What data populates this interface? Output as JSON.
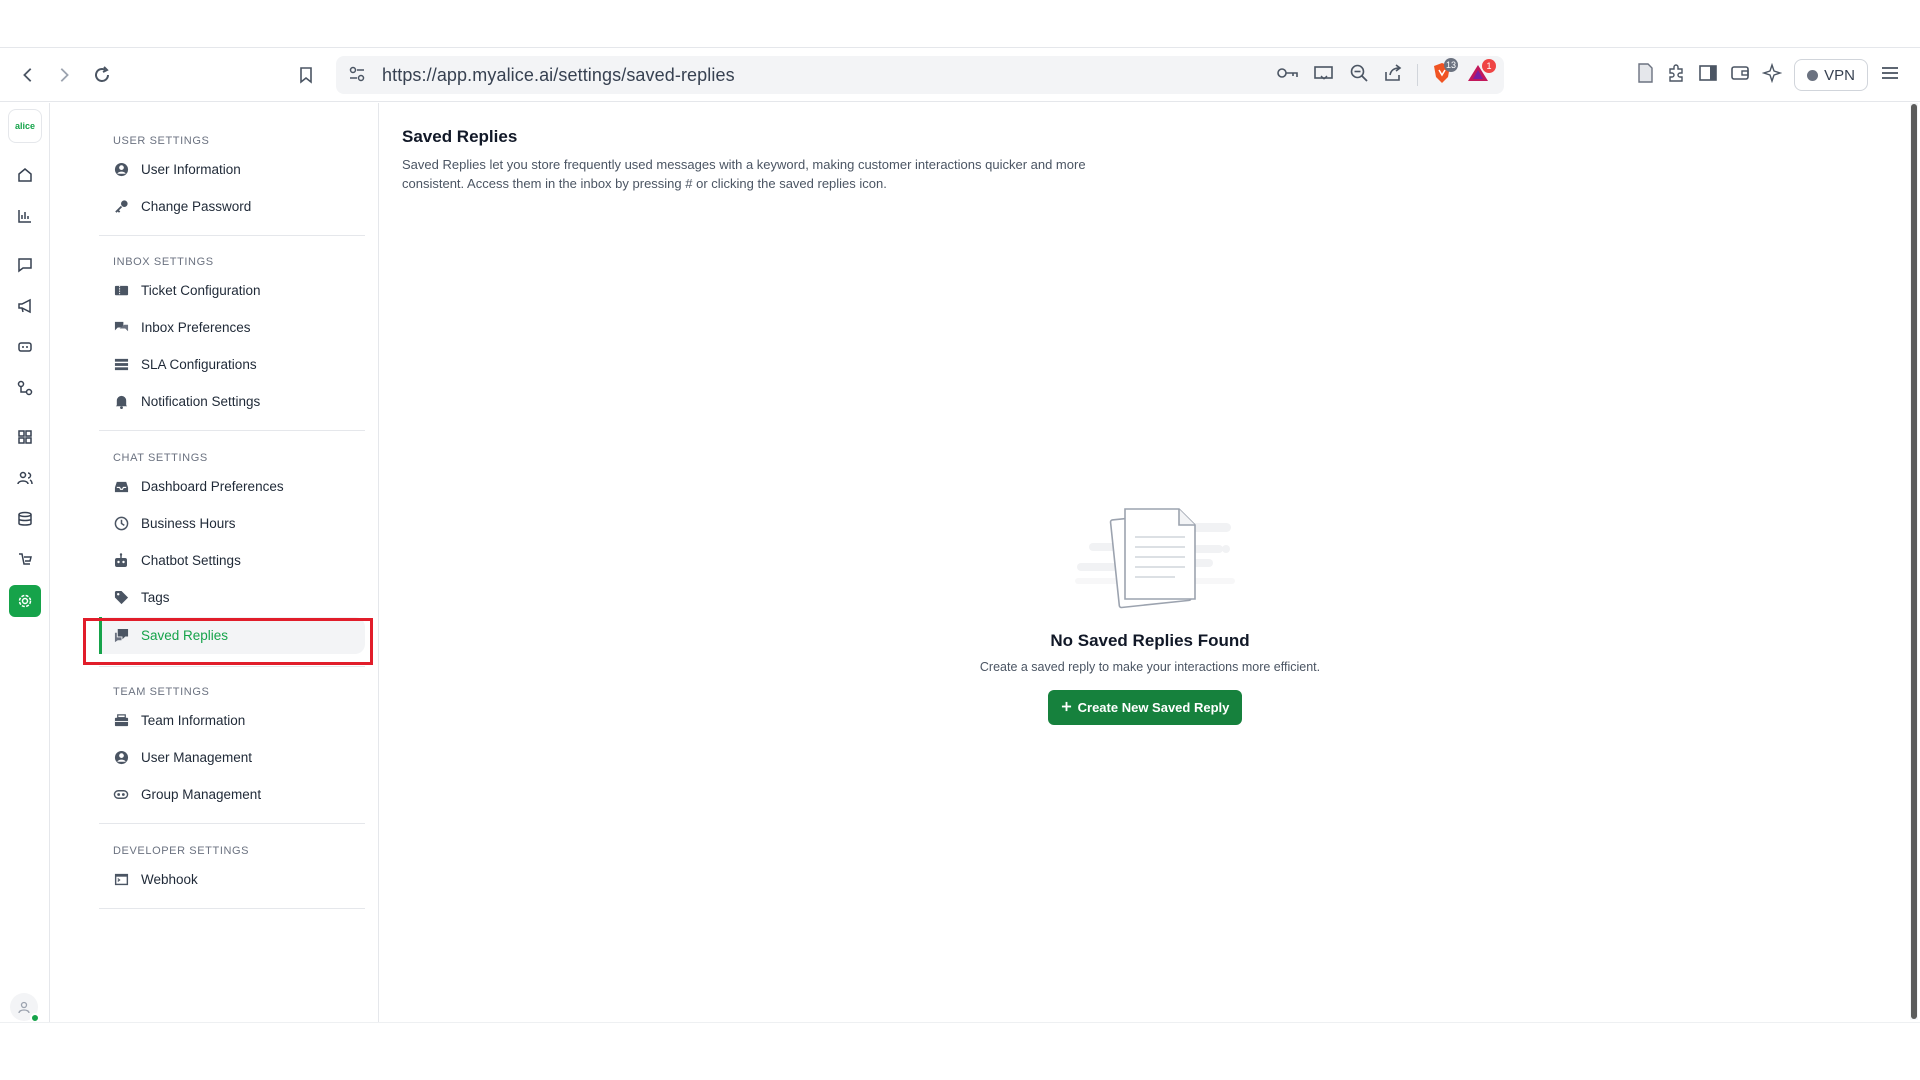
{
  "browser": {
    "url": "https://app.myalice.ai/settings/saved-replies",
    "brave_badge": "13",
    "rewards_badge": "1",
    "vpn_label": "VPN"
  },
  "rail": {
    "logo_text": "alice"
  },
  "settings_nav": {
    "sections": [
      {
        "heading": "USER SETTINGS",
        "items": [
          {
            "label": "User Information"
          },
          {
            "label": "Change Password"
          }
        ]
      },
      {
        "heading": "INBOX SETTINGS",
        "items": [
          {
            "label": "Ticket Configuration"
          },
          {
            "label": "Inbox Preferences"
          },
          {
            "label": "SLA Configurations"
          },
          {
            "label": "Notification Settings"
          }
        ]
      },
      {
        "heading": "CHAT SETTINGS",
        "items": [
          {
            "label": "Dashboard Preferences"
          },
          {
            "label": "Business Hours"
          },
          {
            "label": "Chatbot Settings"
          },
          {
            "label": "Tags"
          },
          {
            "label": "Saved Replies"
          }
        ]
      },
      {
        "heading": "TEAM SETTINGS",
        "items": [
          {
            "label": "Team Information"
          },
          {
            "label": "User Management"
          },
          {
            "label": "Group Management"
          }
        ]
      },
      {
        "heading": "DEVELOPER SETTINGS",
        "items": [
          {
            "label": "Webhook"
          }
        ]
      }
    ],
    "active_item": "Saved Replies"
  },
  "main": {
    "title": "Saved Replies",
    "description": "Saved Replies let you store frequently used messages with a keyword, making customer interactions quicker and more consistent. Access them in the inbox by pressing # or clicking the saved replies icon.",
    "empty_state": {
      "title": "No Saved Replies Found",
      "subtitle": "Create a saved reply to make your interactions more efficient.",
      "button_label": "Create New Saved Reply"
    }
  },
  "colors": {
    "accent": "#16a34a",
    "button": "#16813d",
    "highlight": "#e11d2a"
  }
}
